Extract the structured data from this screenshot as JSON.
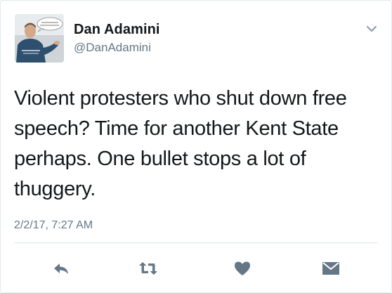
{
  "tweet": {
    "author_name": "Dan Adamini",
    "author_handle": "@DanAdamini",
    "text": "Violent protesters who shut down free speech? Time for another Kent State perhaps. One bullet stops a lot of thuggery.",
    "timestamp": "2/2/17, 7:27 AM"
  },
  "icons": {
    "more": "chevron-down-icon",
    "reply": "reply-icon",
    "retweet": "retweet-icon",
    "like": "heart-icon",
    "message": "envelope-icon"
  },
  "colors": {
    "icon": "#657786",
    "text": "#14171a",
    "muted": "#657786",
    "border": "#e1e8ed"
  }
}
